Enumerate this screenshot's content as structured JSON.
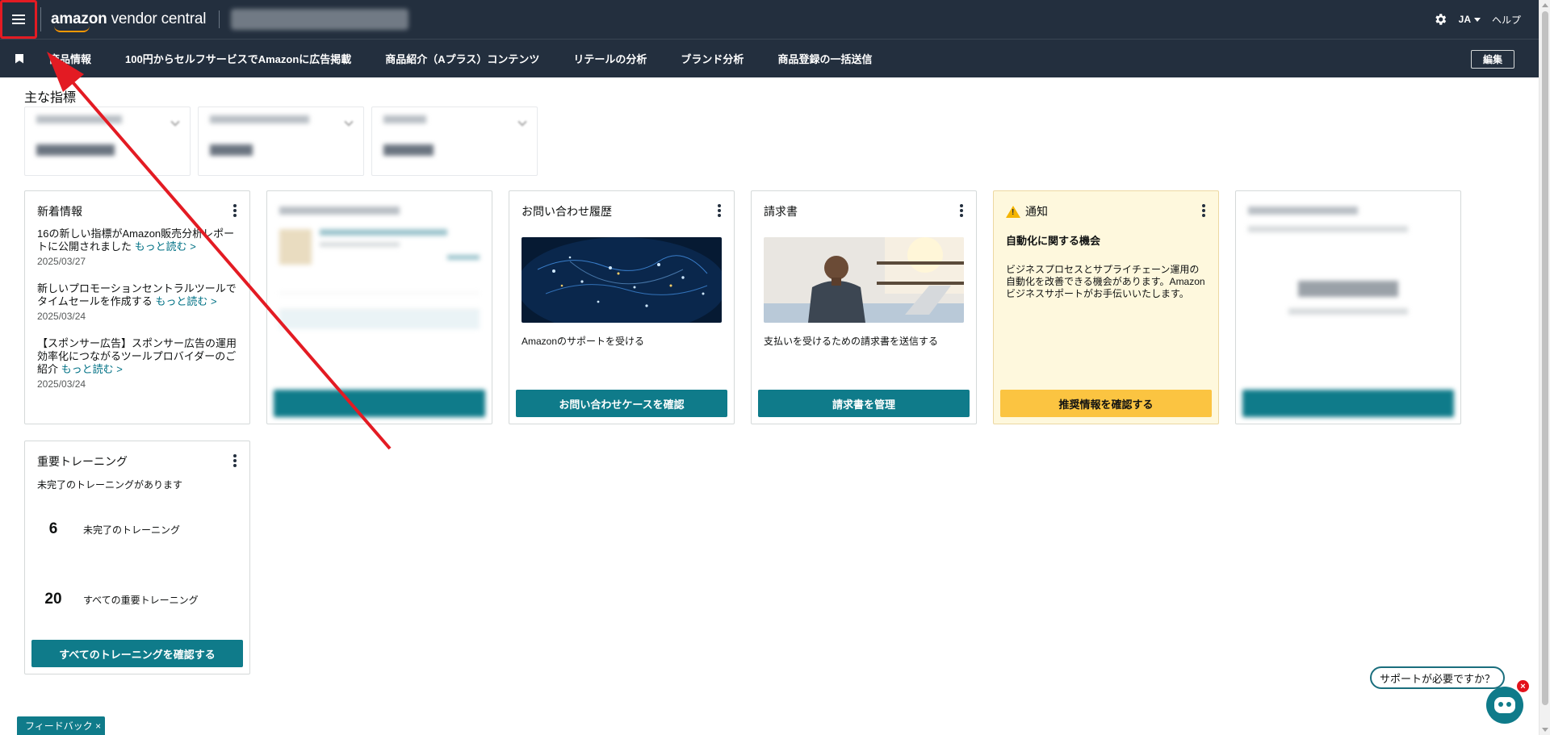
{
  "topbar": {
    "logo_main": "amazon",
    "logo_sub": " vendor central",
    "lang": "JA",
    "help": "ヘルプ"
  },
  "nav": {
    "items": [
      "商品情報",
      "100円からセルフサービスでAmazonに広告掲載",
      "商品紹介（Aプラス）コンテンツ",
      "リテールの分析",
      "ブランド分析",
      "商品登録の一括送信"
    ],
    "edit": "編集"
  },
  "metrics": {
    "title": "主な指標"
  },
  "news": {
    "title": "新着情報",
    "items": [
      {
        "text": "16の新しい指標がAmazon販売分析レポートに公開されました",
        "more": "もっと読む >",
        "date": "2025/03/27"
      },
      {
        "text": "新しいプロモーションセントラルツールでタイムセールを作成する",
        "more": "もっと読む >",
        "date": "2025/03/24"
      },
      {
        "text": "【スポンサー広告】スポンサー広告の運用効率化につながるツールプロバイダーのご紹介",
        "more": "もっと読む >",
        "date": "2025/03/24"
      }
    ]
  },
  "inquiry": {
    "title": "お問い合わせ履歴",
    "desc": "Amazonのサポートを受ける",
    "button": "お問い合わせケースを確認"
  },
  "invoice": {
    "title": "請求書",
    "desc": "支払いを受けるための請求書を送信する",
    "button": "請求書を管理"
  },
  "notice": {
    "title": "通知",
    "heading": "自動化に関する機会",
    "body": "ビジネスプロセスとサプライチェーン運用の自動化を改善できる機会があります。Amazonビジネスサポートがお手伝いいたします。",
    "button": "推奨情報を確認する"
  },
  "training": {
    "title": "重要トレーニング",
    "subtitle": "未完了のトレーニングがあります",
    "incomplete_count": "6",
    "incomplete_label": "未完了のトレーニング",
    "all_count": "20",
    "all_label": "すべての重要トレーニング",
    "button": "すべてのトレーニングを確認する"
  },
  "feedback": "フィードバック ×",
  "help_bubble": "サポートが必要ですか？",
  "colors": {
    "header_bg": "#232f3e",
    "teal_button": "#0f7b8a",
    "yellow_button": "#fbc441",
    "annotation_red": "#e31b23"
  }
}
